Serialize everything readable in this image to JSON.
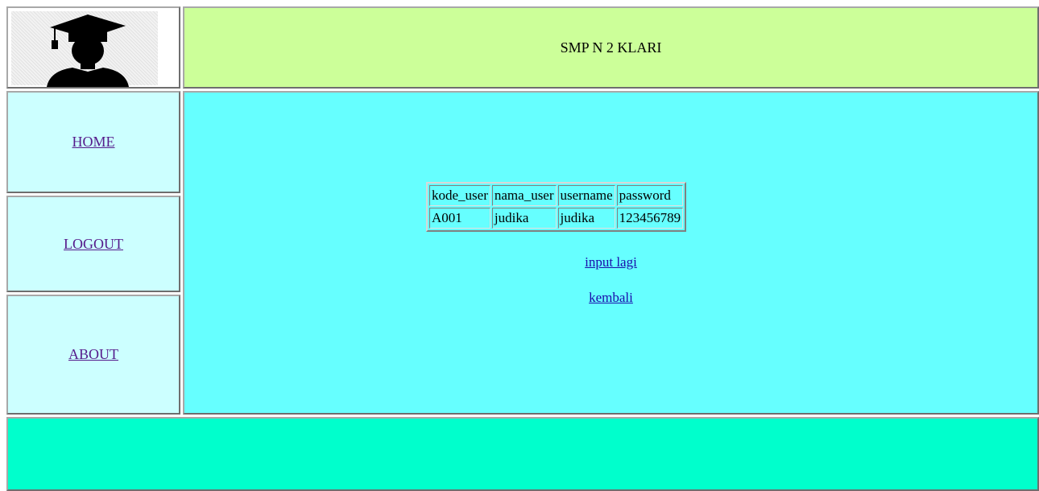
{
  "header": {
    "title": "SMP N 2 KLARI"
  },
  "logo": {
    "icon": "graduate-silhouette-icon"
  },
  "nav": {
    "home": "HOME",
    "logout": "LOGOUT",
    "about": "ABOUT"
  },
  "table": {
    "headers": [
      "kode_user",
      "nama_user",
      "username",
      "password"
    ],
    "rows": [
      [
        "A001",
        "judika",
        "judika",
        "123456789"
      ]
    ]
  },
  "links": {
    "input_again": "input lagi",
    "back": "kembali"
  },
  "colors": {
    "header_bg": "#ccff99",
    "nav_bg": "#ccffff",
    "main_bg": "#66ffff",
    "footer_bg": "#00ffcc",
    "link_visited": "#551a8b",
    "link": "#1a0dab"
  }
}
